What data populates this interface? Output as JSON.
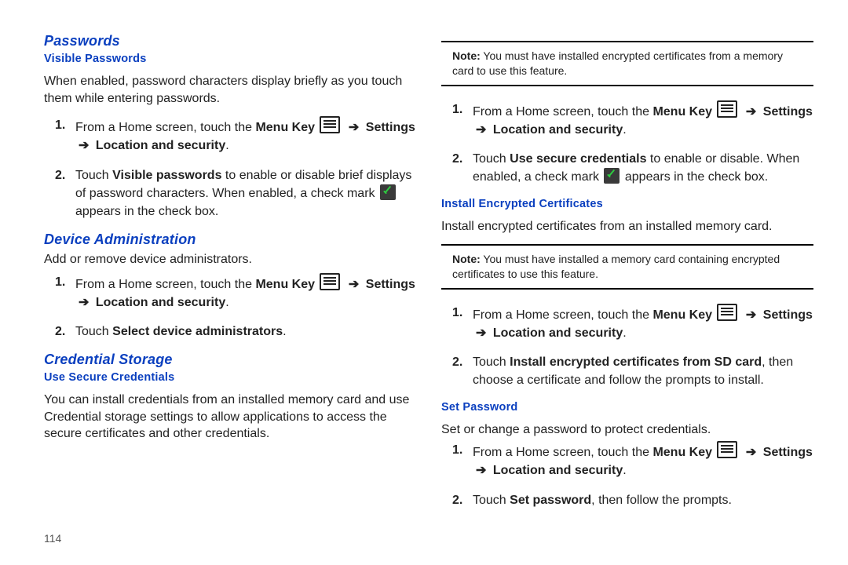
{
  "page_number": "114",
  "left": {
    "h_passwords": "Passwords",
    "h_visible_passwords": "Visible Passwords",
    "visible_passwords_desc": "When enabled, password characters display briefly as you touch them while entering passwords.",
    "step_home_prefix": "From a Home screen, touch the ",
    "menu_key_label": "Menu Key",
    "arrow": "➔",
    "settings_label": "Settings",
    "location_security_label": "Location and security",
    "visible_passwords_step2_a": "Touch ",
    "visible_passwords_bold": "Visible passwords",
    "visible_passwords_step2_b": " to enable or disable brief displays of password characters. When enabled, a check mark ",
    "appears_in_checkbox": " appears in the check box.",
    "h_device_admin": "Device Administration",
    "device_admin_desc": "Add or remove device administrators.",
    "device_admin_step2_a": "Touch ",
    "device_admin_bold": "Select device administrators",
    "h_credential_storage": "Credential Storage",
    "h_use_secure": "Use Secure Credentials",
    "use_secure_desc": "You can install credentials from an installed memory card and use Credential storage settings to allow applications to access the secure certificates and other credentials."
  },
  "right": {
    "note1_label": "Note:",
    "note1_text": " You must have installed encrypted certificates from a memory card to use this feature.",
    "step_home_prefix": "From a Home screen, touch the ",
    "menu_key_label": "Menu Key",
    "arrow": "➔",
    "settings_label": "Settings",
    "location_security_label": "Location and security",
    "use_secure_step2_a": "Touch ",
    "use_secure_bold": "Use secure credentials",
    "use_secure_step2_b": " to enable or disable. When enabled, a check mark ",
    "appears_in_checkbox": " appears in the check box.",
    "h_install_cert": "Install Encrypted Certificates",
    "install_cert_desc": "Install encrypted certificates from an installed memory card.",
    "note2_label": "Note:",
    "note2_text": " You must have installed a memory card containing encrypted certificates to use this feature.",
    "install_step2_a": "Touch ",
    "install_bold": "Install encrypted certificates from SD card",
    "install_step2_b": ", then choose a certificate and follow the prompts to install.",
    "h_set_password": "Set Password",
    "set_password_desc": "Set or change a password to protect credentials.",
    "setpw_step2_a": "Touch ",
    "setpw_bold": "Set password",
    "setpw_step2_b": ", then follow the prompts."
  }
}
